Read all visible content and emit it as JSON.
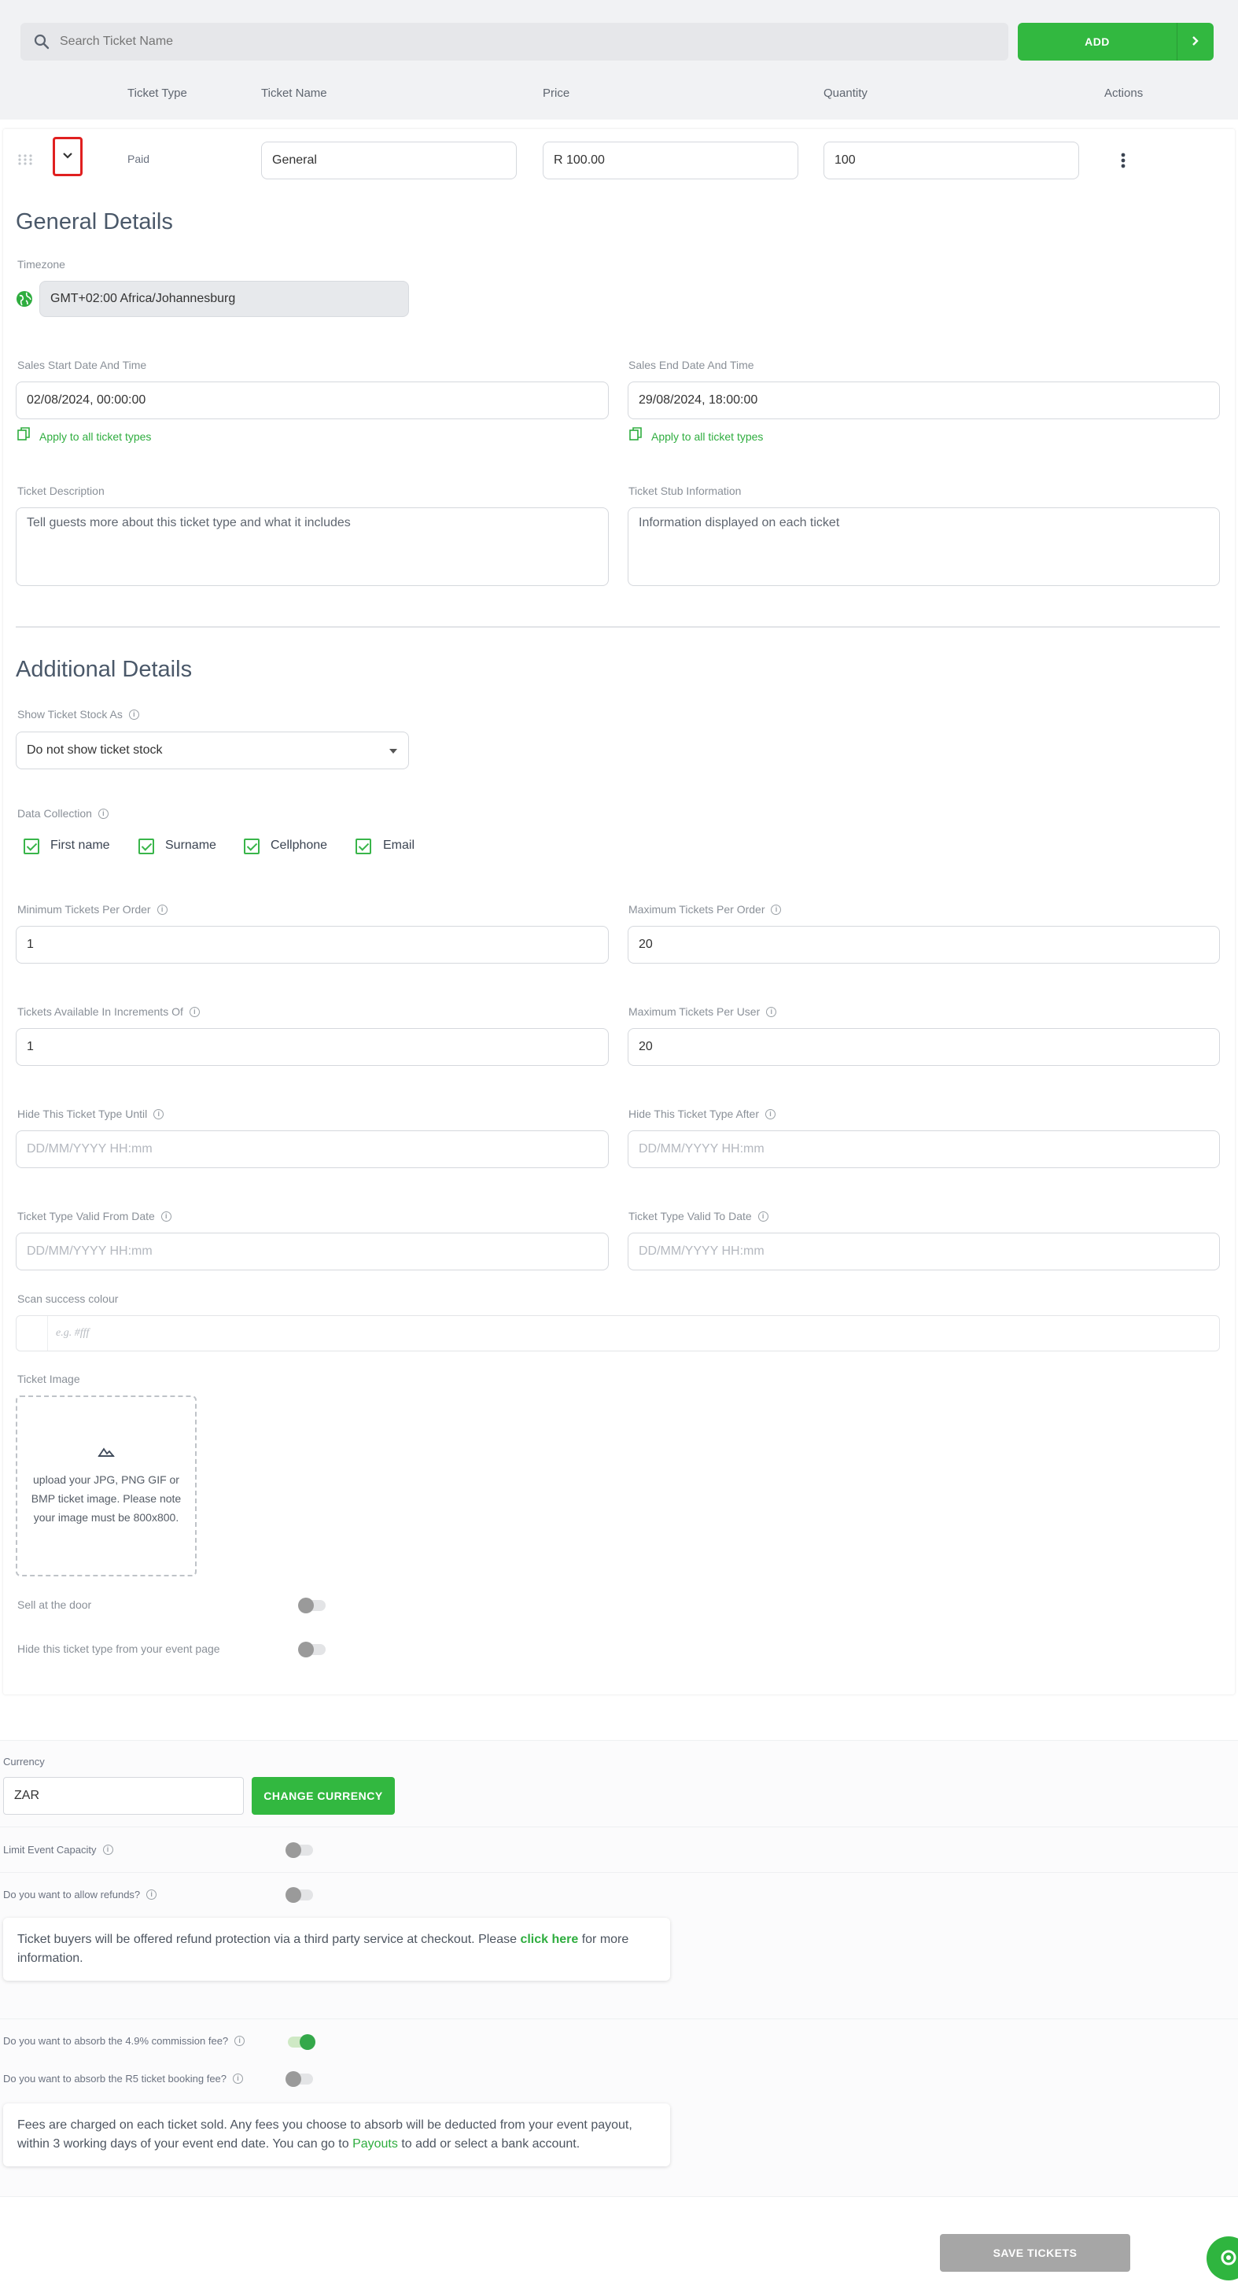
{
  "search": {
    "placeholder": "Search Ticket Name"
  },
  "add_button": {
    "label": "ADD"
  },
  "table": {
    "headers": {
      "ticket_type": "Ticket Type",
      "ticket_name": "Ticket Name",
      "price": "Price",
      "quantity": "Quantity",
      "actions": "Actions"
    },
    "row": {
      "ticket_type": "Paid",
      "ticket_name": "General",
      "price": "R 100.00",
      "quantity": "100"
    }
  },
  "general": {
    "title": "General Details",
    "timezone_label": "Timezone",
    "timezone_value": "GMT+02:00 Africa/Johannesburg",
    "sales_start_label": "Sales Start Date And Time",
    "sales_start_value": "02/08/2024, 00:00:00",
    "sales_end_label": "Sales End Date And Time",
    "sales_end_value": "29/08/2024, 18:00:00",
    "apply_all": "Apply to all ticket types",
    "description_label": "Ticket Description",
    "description_placeholder": "Tell guests more about this ticket type and what it includes",
    "stub_label": "Ticket Stub Information",
    "stub_placeholder": "Information displayed on each ticket"
  },
  "additional": {
    "title": "Additional Details",
    "stock_label": "Show Ticket Stock As",
    "stock_value": "Do not show ticket stock",
    "data_collection_label": "Data Collection",
    "data_collection": [
      "First name",
      "Surname",
      "Cellphone",
      "Email"
    ],
    "min_per_order_label": "Minimum Tickets Per Order",
    "min_per_order_value": "1",
    "max_per_order_label": "Maximum Tickets Per Order",
    "max_per_order_value": "20",
    "increments_label": "Tickets Available In Increments Of",
    "increments_value": "1",
    "max_per_user_label": "Maximum Tickets Per User",
    "max_per_user_value": "20",
    "hide_until_label": "Hide This Ticket Type Until",
    "hide_after_label": "Hide This Ticket Type After",
    "valid_from_label": "Ticket Type Valid From Date",
    "valid_to_label": "Ticket Type Valid To Date",
    "date_placeholder": "DD/MM/YYYY HH:mm",
    "scan_colour_label": "Scan success colour",
    "scan_colour_placeholder": "e.g. #fff",
    "image_label": "Ticket Image",
    "image_hint": "upload your JPG, PNG GIF or BMP ticket image. Please note your image must be 800x800.",
    "sell_door_label": "Sell at the door",
    "sell_door_on": false,
    "hide_event_label": "Hide this ticket type from your event page",
    "hide_event_on": false
  },
  "currency": {
    "label": "Currency",
    "value": "ZAR",
    "change_label": "CHANGE CURRENCY"
  },
  "capacity": {
    "label": "Limit Event Capacity",
    "on": false
  },
  "refunds": {
    "label": "Do you want to allow refunds?",
    "on": false,
    "note_before": "Ticket buyers will be offered refund protection via a third party service at checkout. Please ",
    "note_link": "click here",
    "note_after": " for more information."
  },
  "commission": {
    "label": "Do you want to absorb the 4.9% commission fee?",
    "on": true
  },
  "booking_fee": {
    "label": "Do you want to absorb the R5 ticket booking fee?",
    "on": false
  },
  "fees_note": {
    "before": "Fees are charged on each ticket sold. Any fees you choose to absorb will be deducted from your event payout, within 3 working days of your event end date. You can go to ",
    "link": "Payouts",
    "after": " to add or select a bank account."
  },
  "save_button": {
    "label": "SAVE TICKETS"
  },
  "colors": {
    "accent": "#2fb53f",
    "disabled": "#a6a6a6",
    "highlight": "#e02020"
  }
}
